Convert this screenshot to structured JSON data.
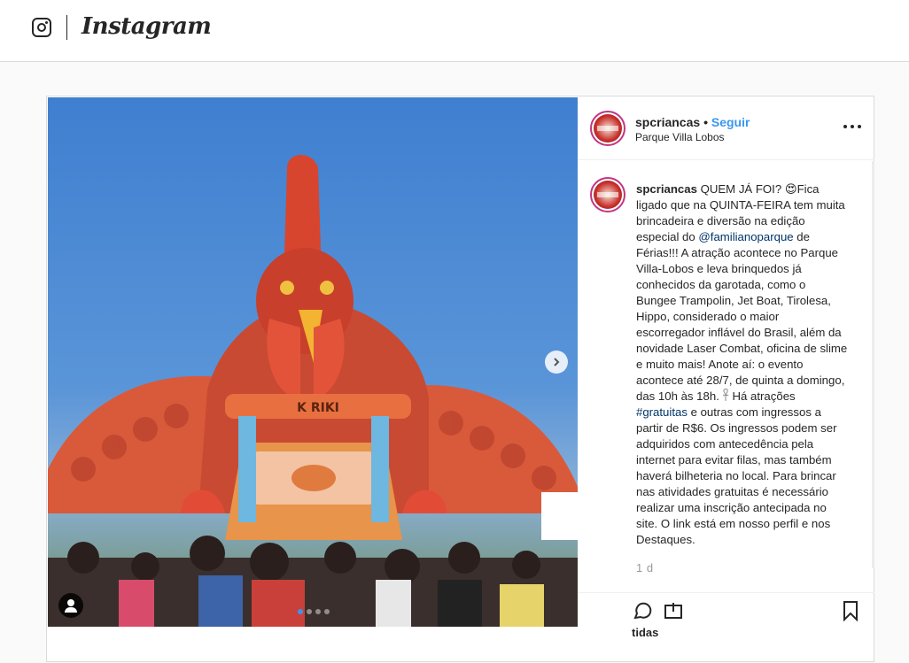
{
  "header": {
    "brand": "Instagram"
  },
  "post": {
    "username": "spcriancas",
    "separator": "•",
    "follow_label": "Seguir",
    "location": "Parque Villa Lobos",
    "caption_user": "spcriancas",
    "caption_part1": "QUEM JÁ FOI? 😍Fica ligado que na QUINTA-FEIRA tem muita brincadeira e diversão na edição especial do ",
    "mention": "@familianoparque",
    "caption_part2": " de Férias!!! A atração acontece no Parque Villa-Lobos e leva brinquedos já conhecidos da garotada, como o Bungee Trampolin, Jet Boat, Tirolesa, Hippo, considerado o maior escorregador inflável do Brasil, além da novidade Laser Combat, oficina de slime e muito mais! Anote aí: o evento acontece até 28/7, de quinta a domingo, das 10h às 18h. 𓋹 Há atrações ",
    "hashtag": "#gratuitas",
    "caption_part3": " e outras com ingressos a partir de R$6. Os ingressos podem ser adquiridos com antecedência pela internet para evitar filas, mas também haverá bilheteria no local. Para brincar nas atividades gratuitas é necessário realizar uma inscrição antecipada no site. O link está em nosso perfil e nos Destaques.",
    "time": "1 d",
    "likes_fragment": "tidas"
  },
  "carousel": {
    "slide_count": 4,
    "active_index": 0
  },
  "icons": {
    "brand_icon": "instagram-glyph-icon",
    "next": "chevron-right-icon",
    "user_tag": "user-tag-icon",
    "more": "more-options-icon",
    "comment": "comment-icon",
    "share": "share-icon",
    "save": "bookmark-icon"
  },
  "colors": {
    "link": "#3897f0",
    "mention": "#003569",
    "border": "#dbdbdb"
  }
}
